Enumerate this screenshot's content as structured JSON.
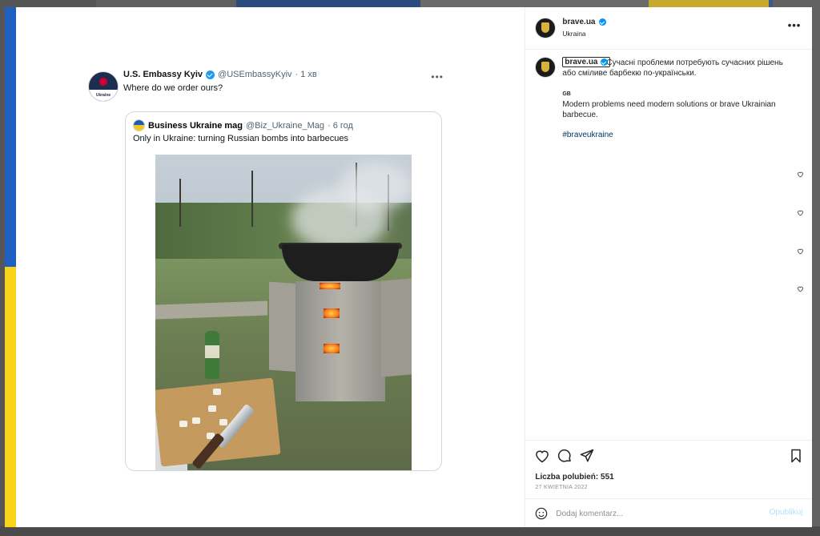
{
  "tweet": {
    "name": "U.S. Embassy Kyiv",
    "handle": "@USEmbassyKyiv",
    "time": "· 1 хв",
    "text": "Where do we order ours?",
    "more": "•••",
    "avatar_text": "Ukraine",
    "quoted": {
      "name": "Business Ukraine mag",
      "handle": "@Biz_Ukraine_Mag",
      "time": "· 6 год",
      "text": "Only in Ukraine: turning Russian bombs into barbecues"
    }
  },
  "post": {
    "username": "brave.ua",
    "location": "Ukraina",
    "more": "•••",
    "caption_ua": "Сучасні проблеми потребують сучасних рішень або сміливе барбекю по-українськи.",
    "caption_gb": "GB",
    "caption_en": "Modern problems need modern solutions or brave Ukrainian barbecue.",
    "hashtag": "#braveukraine",
    "likes": "Liczba polubień: 551",
    "date": "27 KWIETNIA 2022",
    "comment_placeholder": "Dodaj komentarz...",
    "publish": "Opublikuj"
  },
  "icons": [
    "heart-icon",
    "comment-icon",
    "share-icon",
    "bookmark-icon",
    "emoji-icon",
    "verified-badge-icon",
    "more-options-icon"
  ],
  "colors": {
    "flag_blue": "#1f5fc2",
    "flag_yellow": "#f7d417",
    "link": "#00376b",
    "verified": "#0095f6"
  }
}
